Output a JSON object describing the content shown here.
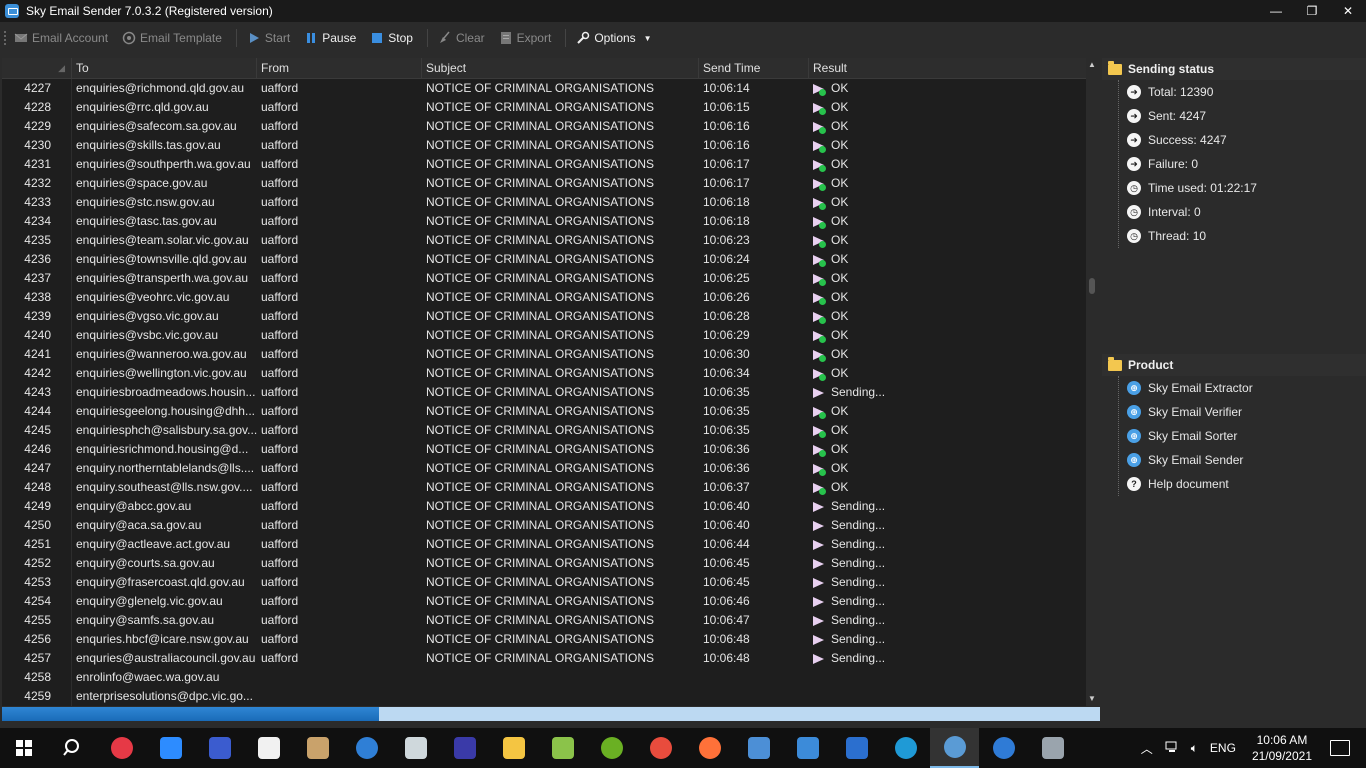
{
  "window": {
    "title": "Sky Email Sender 7.0.3.2 (Registered version)",
    "controls": [
      "—",
      "❐",
      "✕"
    ]
  },
  "toolbar": {
    "email_account": "Email Account",
    "email_template": "Email Template",
    "start": "Start",
    "pause": "Pause",
    "stop": "Stop",
    "clear": "Clear",
    "export": "Export",
    "options": "Options"
  },
  "grid": {
    "columns": {
      "to": "To",
      "from": "From",
      "subject": "Subject",
      "send_time": "Send Time",
      "result": "Result"
    },
    "rows": [
      {
        "num": "4227",
        "to": "enquiries@richmond.qld.gov.au",
        "from": "uafford",
        "subject": "NOTICE OF CRIMINAL ORGANISATIONS",
        "time": "10:06:14",
        "result": "OK"
      },
      {
        "num": "4228",
        "to": "enquiries@rrc.qld.gov.au",
        "from": "uafford",
        "subject": "NOTICE OF CRIMINAL ORGANISATIONS",
        "time": "10:06:15",
        "result": "OK"
      },
      {
        "num": "4229",
        "to": "enquiries@safecom.sa.gov.au",
        "from": "uafford",
        "subject": "NOTICE OF CRIMINAL ORGANISATIONS",
        "time": "10:06:16",
        "result": "OK"
      },
      {
        "num": "4230",
        "to": "enquiries@skills.tas.gov.au",
        "from": "uafford",
        "subject": "NOTICE OF CRIMINAL ORGANISATIONS",
        "time": "10:06:16",
        "result": "OK"
      },
      {
        "num": "4231",
        "to": "enquiries@southperth.wa.gov.au",
        "from": "uafford",
        "subject": "NOTICE OF CRIMINAL ORGANISATIONS",
        "time": "10:06:17",
        "result": "OK"
      },
      {
        "num": "4232",
        "to": "enquiries@space.gov.au",
        "from": "uafford",
        "subject": "NOTICE OF CRIMINAL ORGANISATIONS",
        "time": "10:06:17",
        "result": "OK"
      },
      {
        "num": "4233",
        "to": "enquiries@stc.nsw.gov.au",
        "from": "uafford",
        "subject": "NOTICE OF CRIMINAL ORGANISATIONS",
        "time": "10:06:18",
        "result": "OK"
      },
      {
        "num": "4234",
        "to": "enquiries@tasc.tas.gov.au",
        "from": "uafford",
        "subject": "NOTICE OF CRIMINAL ORGANISATIONS",
        "time": "10:06:18",
        "result": "OK"
      },
      {
        "num": "4235",
        "to": "enquiries@team.solar.vic.gov.au",
        "from": "uafford",
        "subject": "NOTICE OF CRIMINAL ORGANISATIONS",
        "time": "10:06:23",
        "result": "OK"
      },
      {
        "num": "4236",
        "to": "enquiries@townsville.qld.gov.au",
        "from": "uafford",
        "subject": "NOTICE OF CRIMINAL ORGANISATIONS",
        "time": "10:06:24",
        "result": "OK"
      },
      {
        "num": "4237",
        "to": "enquiries@transperth.wa.gov.au",
        "from": "uafford",
        "subject": "NOTICE OF CRIMINAL ORGANISATIONS",
        "time": "10:06:25",
        "result": "OK"
      },
      {
        "num": "4238",
        "to": "enquiries@veohrc.vic.gov.au",
        "from": "uafford",
        "subject": "NOTICE OF CRIMINAL ORGANISATIONS",
        "time": "10:06:26",
        "result": "OK"
      },
      {
        "num": "4239",
        "to": "enquiries@vgso.vic.gov.au",
        "from": "uafford",
        "subject": "NOTICE OF CRIMINAL ORGANISATIONS",
        "time": "10:06:28",
        "result": "OK"
      },
      {
        "num": "4240",
        "to": "enquiries@vsbc.vic.gov.au",
        "from": "uafford",
        "subject": "NOTICE OF CRIMINAL ORGANISATIONS",
        "time": "10:06:29",
        "result": "OK"
      },
      {
        "num": "4241",
        "to": "enquiries@wanneroo.wa.gov.au",
        "from": "uafford",
        "subject": "NOTICE OF CRIMINAL ORGANISATIONS",
        "time": "10:06:30",
        "result": "OK"
      },
      {
        "num": "4242",
        "to": "enquiries@wellington.vic.gov.au",
        "from": "uafford",
        "subject": "NOTICE OF CRIMINAL ORGANISATIONS",
        "time": "10:06:34",
        "result": "OK"
      },
      {
        "num": "4243",
        "to": "enquiriesbroadmeadows.housin...",
        "from": "uafford",
        "subject": "NOTICE OF CRIMINAL ORGANISATIONS",
        "time": "10:06:35",
        "result": "Sending..."
      },
      {
        "num": "4244",
        "to": "enquiriesgeelong.housing@dhh...",
        "from": "uafford",
        "subject": "NOTICE OF CRIMINAL ORGANISATIONS",
        "time": "10:06:35",
        "result": "OK"
      },
      {
        "num": "4245",
        "to": "enquiriesphch@salisbury.sa.gov...",
        "from": "uafford",
        "subject": "NOTICE OF CRIMINAL ORGANISATIONS",
        "time": "10:06:35",
        "result": "OK"
      },
      {
        "num": "4246",
        "to": "enquiriesrichmond.housing@d...",
        "from": "uafford",
        "subject": "NOTICE OF CRIMINAL ORGANISATIONS",
        "time": "10:06:36",
        "result": "OK"
      },
      {
        "num": "4247",
        "to": "enquiry.northerntablelands@lls....",
        "from": "uafford",
        "subject": "NOTICE OF CRIMINAL ORGANISATIONS",
        "time": "10:06:36",
        "result": "OK"
      },
      {
        "num": "4248",
        "to": "enquiry.southeast@lls.nsw.gov....",
        "from": "uafford",
        "subject": "NOTICE OF CRIMINAL ORGANISATIONS",
        "time": "10:06:37",
        "result": "OK"
      },
      {
        "num": "4249",
        "to": "enquiry@abcc.gov.au",
        "from": "uafford",
        "subject": "NOTICE OF CRIMINAL ORGANISATIONS",
        "time": "10:06:40",
        "result": "Sending..."
      },
      {
        "num": "4250",
        "to": "enquiry@aca.sa.gov.au",
        "from": "uafford",
        "subject": "NOTICE OF CRIMINAL ORGANISATIONS",
        "time": "10:06:40",
        "result": "Sending..."
      },
      {
        "num": "4251",
        "to": "enquiry@actleave.act.gov.au",
        "from": "uafford",
        "subject": "NOTICE OF CRIMINAL ORGANISATIONS",
        "time": "10:06:44",
        "result": "Sending..."
      },
      {
        "num": "4252",
        "to": "enquiry@courts.sa.gov.au",
        "from": "uafford",
        "subject": "NOTICE OF CRIMINAL ORGANISATIONS",
        "time": "10:06:45",
        "result": "Sending..."
      },
      {
        "num": "4253",
        "to": "enquiry@frasercoast.qld.gov.au",
        "from": "uafford",
        "subject": "NOTICE OF CRIMINAL ORGANISATIONS",
        "time": "10:06:45",
        "result": "Sending..."
      },
      {
        "num": "4254",
        "to": "enquiry@glenelg.vic.gov.au",
        "from": "uafford",
        "subject": "NOTICE OF CRIMINAL ORGANISATIONS",
        "time": "10:06:46",
        "result": "Sending..."
      },
      {
        "num": "4255",
        "to": "enquiry@samfs.sa.gov.au",
        "from": "uafford",
        "subject": "NOTICE OF CRIMINAL ORGANISATIONS",
        "time": "10:06:47",
        "result": "Sending..."
      },
      {
        "num": "4256",
        "to": "enquries.hbcf@icare.nsw.gov.au",
        "from": "uafford",
        "subject": "NOTICE OF CRIMINAL ORGANISATIONS",
        "time": "10:06:48",
        "result": "Sending..."
      },
      {
        "num": "4257",
        "to": "enquries@australiacouncil.gov.au",
        "from": "uafford",
        "subject": "NOTICE OF CRIMINAL ORGANISATIONS",
        "time": "10:06:48",
        "result": "Sending..."
      },
      {
        "num": "4258",
        "to": "enrolinfo@waec.wa.gov.au",
        "from": "",
        "subject": "",
        "time": "",
        "result": ""
      },
      {
        "num": "4259",
        "to": "enterprisesolutions@dpc.vic.go...",
        "from": "",
        "subject": "",
        "time": "",
        "result": ""
      }
    ]
  },
  "progress": {
    "fraction": 0.343
  },
  "status_panel": {
    "header": "Sending status",
    "items": [
      {
        "icon": "arrow-circle-icon",
        "label": "Total: 12390"
      },
      {
        "icon": "arrow-circle-icon",
        "label": "Sent: 4247"
      },
      {
        "icon": "arrow-circle-icon",
        "label": "Success: 4247"
      },
      {
        "icon": "arrow-circle-icon",
        "label": "Failure: 0"
      },
      {
        "icon": "clock-icon",
        "label": "Time used: 01:22:17"
      },
      {
        "icon": "clock-icon",
        "label": "Interval: 0"
      },
      {
        "icon": "clock-icon",
        "label": "Thread: 10"
      }
    ]
  },
  "product_panel": {
    "header": "Product",
    "items": [
      {
        "icon": "globe-icon",
        "label": "Sky Email Extractor"
      },
      {
        "icon": "globe-icon",
        "label": "Sky Email Verifier"
      },
      {
        "icon": "globe-icon",
        "label": "Sky Email Sorter"
      },
      {
        "icon": "globe-icon",
        "label": "Sky Email Sender"
      },
      {
        "icon": "help-icon",
        "label": "Help document"
      }
    ]
  },
  "taskbar": {
    "language": "ENG",
    "time": "10:06 AM",
    "date": "21/09/2021",
    "apps": [
      "search",
      "app-red",
      "zoom",
      "app-blue",
      "file",
      "paint",
      "cortana",
      "calculator",
      "app-x",
      "folder",
      "notepad",
      "app-green",
      "chrome",
      "firefox",
      "network",
      "photos",
      "document",
      "edge",
      "sky-email-sender",
      "app-wave",
      "app-gray"
    ]
  },
  "colors": {
    "accent": "#1a6bb8",
    "ok_dot": "#27c24c",
    "folder": "#f3c74f"
  }
}
